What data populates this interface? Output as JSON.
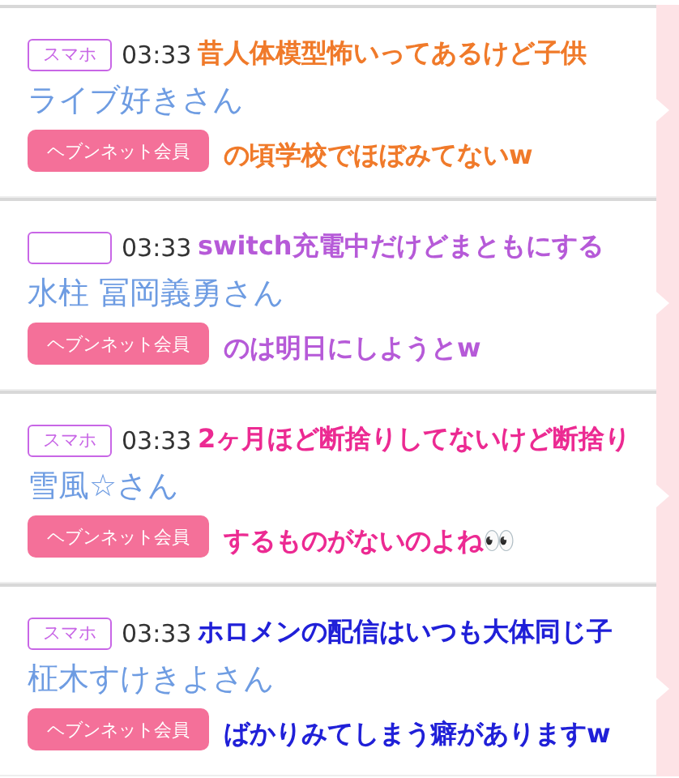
{
  "posts": [
    {
      "badge": "スマホ",
      "time": "03:33",
      "name": "ライブ好きさん",
      "button": "ヘブンネット会員",
      "caption": {
        "color": "#f07a2a",
        "lines": [
          "昔人体模型怖いってあるけど子供",
          "の頃学校でほぼみてないw"
        ]
      }
    },
    {
      "time": "03:33",
      "name": "水柱 冨岡義勇さん",
      "button": "ヘブンネット会員",
      "caption": {
        "color": "#b65ad8",
        "lines": [
          "switch充電中だけどまともにする",
          "のは明日にしようとw"
        ]
      }
    },
    {
      "badge": "スマホ",
      "time": "03:33",
      "name": "雪風☆さん",
      "button": "ヘブンネット会員",
      "caption": {
        "color": "#ec2a92",
        "lines": [
          "2ヶ月ほど断捨りしてないけど断捨り",
          "するものがないのよね👀"
        ]
      }
    },
    {
      "badge": "スマホ",
      "time": "03:33",
      "name": "柾木すけきよさん",
      "button": "ヘブンネット会員",
      "caption": {
        "color": "#2020d8",
        "lines": [
          "ホロメンの配信はいつも大体同じ子",
          "ばかりみてしまう癖がありますw"
        ]
      }
    }
  ]
}
